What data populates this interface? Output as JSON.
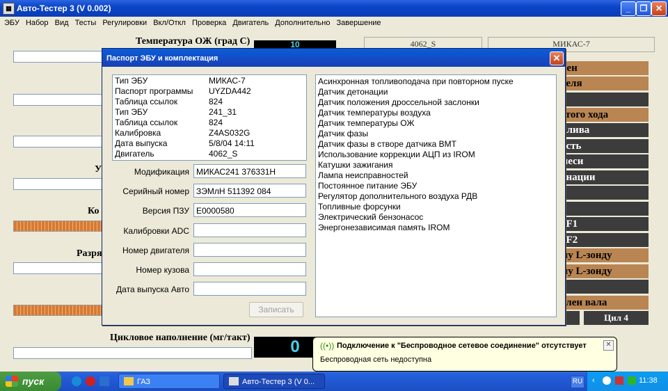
{
  "window": {
    "title": "Авто-Тестер 3  (V 0.002)",
    "app_icon": "monitor-icon",
    "minimize": "_",
    "maximize": "❐",
    "close": "✕"
  },
  "menu": [
    "ЭБУ",
    "Набор",
    "Вид",
    "Тесты",
    "Регулировки",
    "Вкл/Откл",
    "Проверка",
    "Двигатель",
    "Дополнительно",
    "Завершение"
  ],
  "background": {
    "coolant_temp_label": "Температура ОЖ (град С)",
    "coolant_temp_value": "10",
    "engine_header": "4062_S",
    "ecu_header": "МИКАС-7",
    "cyclic_fill_label": "Цикловое наполнение (мг/такт)",
    "cyclic_fill_value": "0",
    "partial_labels": [
      "У",
      "Ко",
      "Разря"
    ],
    "right_buttons": [
      "лен",
      "теля",
      "",
      "стого хода",
      "плива",
      "ость",
      "меси",
      "онации",
      "",
      "",
      "3F1",
      "3F2",
      "му L-зонду",
      "му L-зонду",
      "",
      "олен вала"
    ],
    "cyl_label": "Цил 4"
  },
  "dialog": {
    "title": "Паспорт ЭБУ и комплектация",
    "close": "✕",
    "info": [
      {
        "k": "Тип ЭБУ",
        "v": "МИКАС-7"
      },
      {
        "k": "Паспорт программы",
        "v": "UYZDA442"
      },
      {
        "k": "Таблица ссылок",
        "v": "824"
      },
      {
        "k": "Тип ЭБУ",
        "v": "241_31"
      },
      {
        "k": "Таблица ссылок",
        "v": "824"
      },
      {
        "k": "Калибровка",
        "v": "Z4AS032G"
      },
      {
        "k": "Дата выпуска",
        "v": "5/8/04 14:11"
      },
      {
        "k": "Двигатель",
        "v": "4062_S"
      }
    ],
    "fields": [
      {
        "label": "Модификация",
        "value": "МИКАС241 376331H"
      },
      {
        "label": "Серийный номер",
        "value": "ЗЭМлН 511392 084"
      },
      {
        "label": "Версия ПЗУ",
        "value": "E0000580"
      },
      {
        "label": "Калибровки ADC",
        "value": ""
      },
      {
        "label": "Номер двигателя",
        "value": ""
      },
      {
        "label": "Номер кузова",
        "value": ""
      },
      {
        "label": "Дата выпуска Авто",
        "value": ""
      }
    ],
    "write_button": "Записать",
    "features": [
      "Асинхронная топливоподача при повторном пуске",
      "Датчик детонации",
      "Датчик положения дроссельной заслонки",
      "Датчик температуры воздуха",
      "Датчик температуры ОЖ",
      "Датчик фазы",
      "Датчик фазы в створе датчика ВМТ",
      "Использование коррекции АЦП из IROM",
      "Катушки зажигания",
      "Лампа неисправностей",
      "Постоянное питание ЭБУ",
      "Регулятор дополнительного воздуха РДВ",
      "Топливные форсунки",
      "Электрический бензонасос",
      "Энергонезависимая память IROM"
    ]
  },
  "balloon": {
    "icon": "wireless-network-icon",
    "title": "Подключение  к  \"Беспроводное сетевое соединение\" отсутствует",
    "message": "Беспроводная сеть недоступна",
    "close": "✕"
  },
  "taskbar": {
    "start": "пуск",
    "tasks": [
      {
        "label": "ГАЗ",
        "icon": "folder-icon"
      },
      {
        "label": "Авто-Тестер 3  (V 0...",
        "icon": "monitor-icon"
      }
    ],
    "lang": "RU",
    "clock": "11:38",
    "colors": {
      "taskbar": "#245edb",
      "start": "#3a8a32",
      "tray": "#1290e8"
    }
  }
}
